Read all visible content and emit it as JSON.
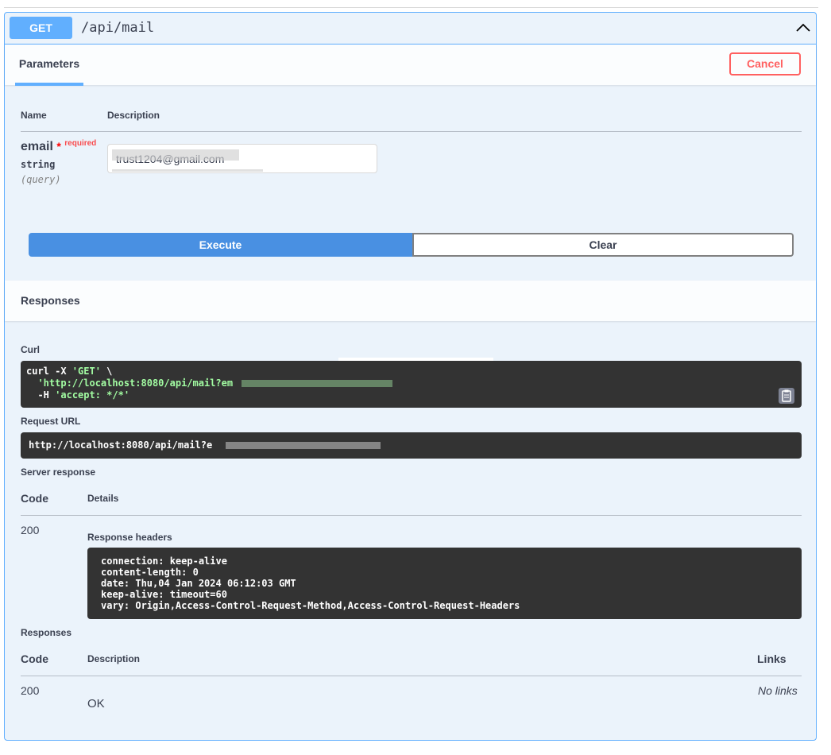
{
  "operation": {
    "method": "GET",
    "path": "/api/mail"
  },
  "parameters": {
    "tab_label": "Parameters",
    "cancel_label": "Cancel",
    "col_name": "Name",
    "col_description": "Description",
    "param": {
      "name": "email",
      "required_star": "*",
      "required_text": "required",
      "type": "string",
      "in": "(query)",
      "value": "trust1204@gmail.com"
    },
    "execute_label": "Execute",
    "clear_label": "Clear"
  },
  "responses_section": {
    "title": "Responses",
    "curl_label": "Curl",
    "curl": {
      "line1_prefix": "curl -X ",
      "line1_method": "'GET'",
      "line1_suffix": " \\",
      "line2": "'http://localhost:8080/api/mail?em",
      "line3_prefix": "-H ",
      "line3_value": "'accept: */*'"
    },
    "request_url_label": "Request URL",
    "request_url": "http://localhost:8080/api/mail?e",
    "server_response_label": "Server response",
    "code_header": "Code",
    "details_header": "Details",
    "status_code": "200",
    "response_headers_label": "Response headers",
    "response_headers": [
      "connection: keep-alive",
      "content-length: 0",
      "date: Thu,04 Jan 2024 06:12:03 GMT",
      "keep-alive: timeout=60",
      "vary: Origin,Access-Control-Request-Method,Access-Control-Request-Headers"
    ]
  },
  "responses_table": {
    "label": "Responses",
    "code_header": "Code",
    "description_header": "Description",
    "links_header": "Links",
    "row_code": "200",
    "row_description": "OK",
    "row_links": "No links"
  },
  "colors": {
    "get_accent": "#61affe",
    "execute": "#4990e2",
    "cancel": "#ff6060",
    "code_bg": "#333333",
    "string_green": "#a2fca2"
  }
}
